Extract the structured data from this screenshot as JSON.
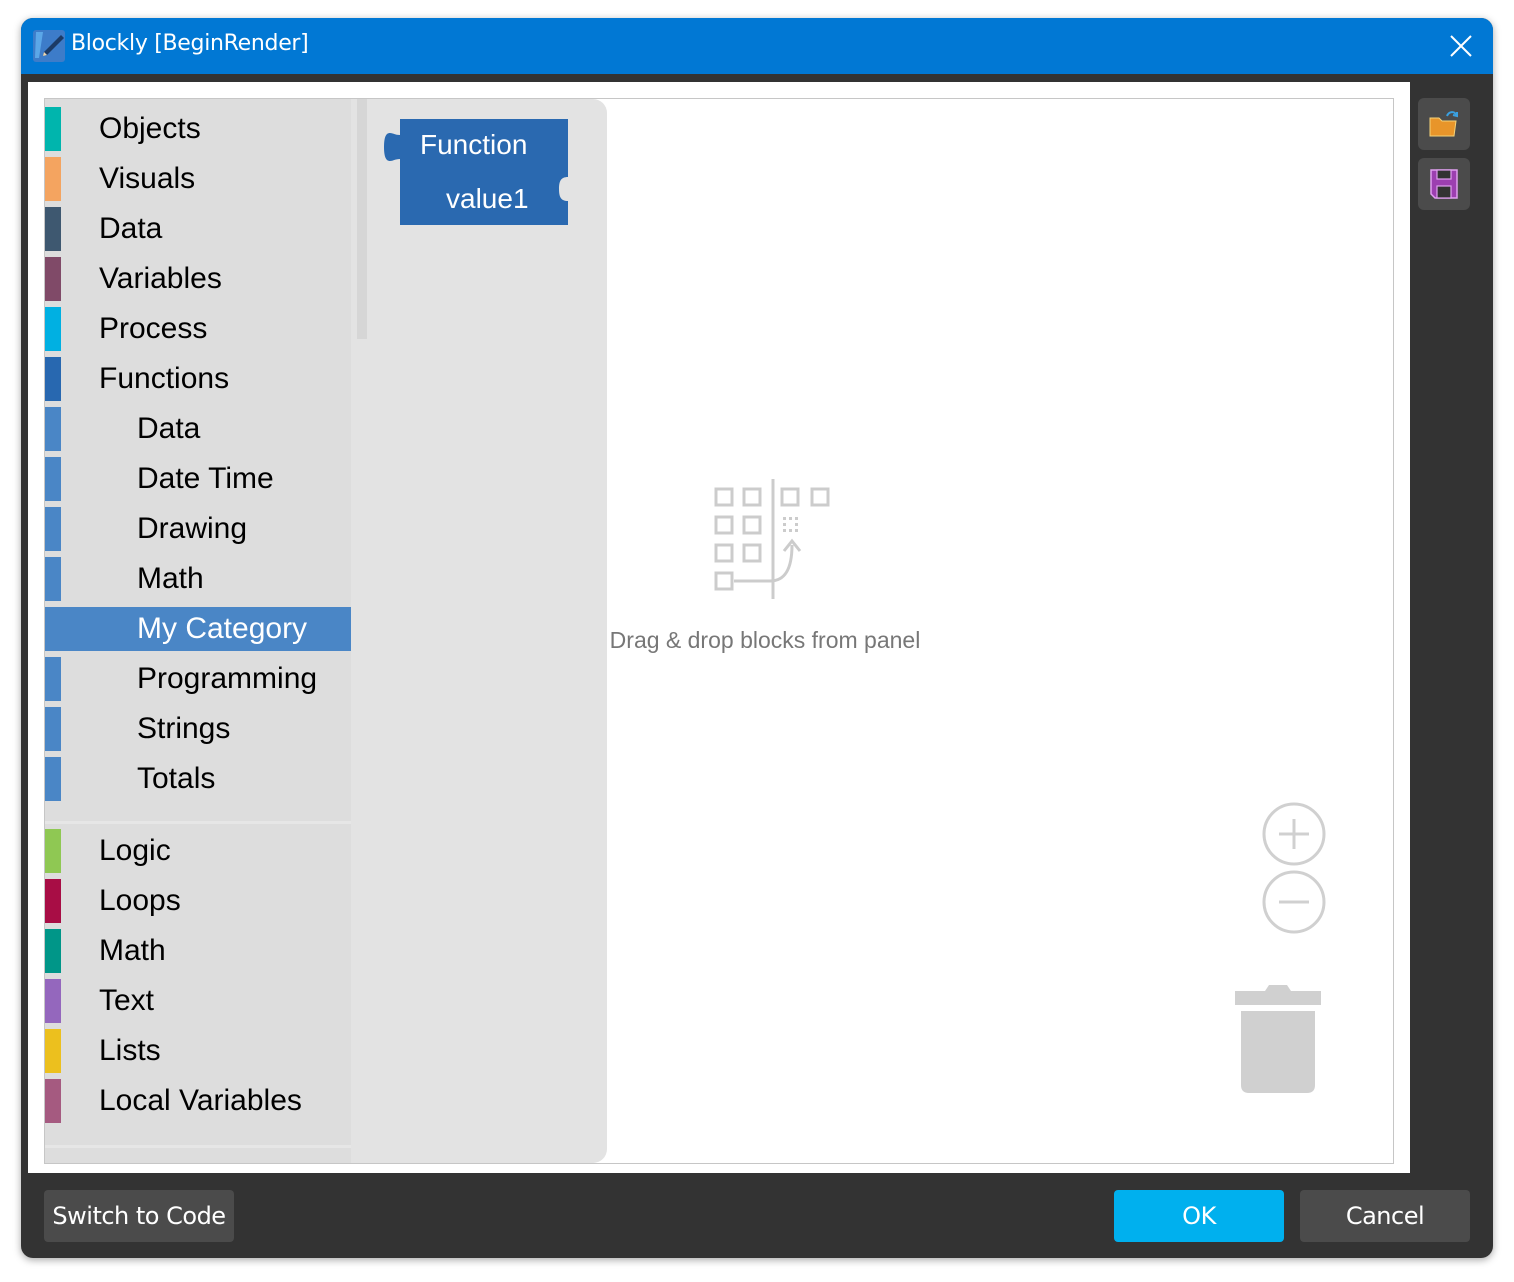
{
  "window": {
    "title": "Blockly [BeginRender]",
    "titlebar_color": "#0178d4",
    "frame_color": "#333333"
  },
  "toolbox": {
    "categories": [
      {
        "label": "Objects",
        "color": "#00b5ad",
        "indent": false
      },
      {
        "label": "Visuals",
        "color": "#f4a460",
        "indent": false
      },
      {
        "label": "Data",
        "color": "#3e5870",
        "indent": false
      },
      {
        "label": "Variables",
        "color": "#804a68",
        "indent": false
      },
      {
        "label": "Process",
        "color": "#00b0e2",
        "indent": false
      },
      {
        "label": "Functions",
        "color": "#2868b0",
        "indent": false
      },
      {
        "label": "Data",
        "color": "#4a86c6",
        "indent": true
      },
      {
        "label": "Date Time",
        "color": "#4a86c6",
        "indent": true
      },
      {
        "label": "Drawing",
        "color": "#4a86c6",
        "indent": true
      },
      {
        "label": "Math",
        "color": "#4a86c6",
        "indent": true
      },
      {
        "label": "My Category",
        "color": "#4a86c6",
        "indent": true,
        "selected": true
      },
      {
        "label": "Programming",
        "color": "#4a86c6",
        "indent": true
      },
      {
        "label": "Strings",
        "color": "#4a86c6",
        "indent": true
      },
      {
        "label": "Totals",
        "color": "#4a86c6",
        "indent": true
      }
    ],
    "standard_categories": [
      {
        "label": "Logic",
        "color": "#8fc853"
      },
      {
        "label": "Loops",
        "color": "#a80d45"
      },
      {
        "label": "Math",
        "color": "#009688"
      },
      {
        "label": "Text",
        "color": "#9467bd"
      },
      {
        "label": "Lists",
        "color": "#ecc01e"
      },
      {
        "label": "Local Variables",
        "color": "#a55a80"
      }
    ]
  },
  "flyout": {
    "block": {
      "title": "Function",
      "input_label": "value1",
      "color": "#2a69b0"
    }
  },
  "workspace": {
    "empty_hint": "Drag & drop blocks from panel",
    "zoom_in": "zoom-in",
    "zoom_out": "zoom-out",
    "trash": "trash"
  },
  "side_buttons": {
    "open": "open-file",
    "save": "save-file"
  },
  "footer": {
    "switch_label": "Switch to Code",
    "ok_label": "OK",
    "cancel_label": "Cancel",
    "ok_color": "#00b0ee"
  }
}
